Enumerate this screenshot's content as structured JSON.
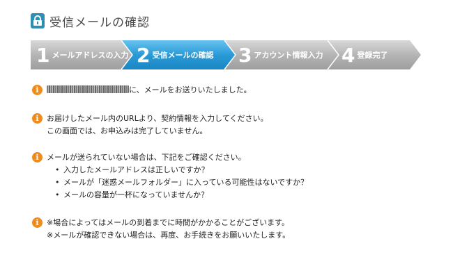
{
  "header": {
    "title": "受信メールの確認",
    "icon": "lock-icon",
    "accent": "#2e8fb5"
  },
  "steps": [
    {
      "num": "1",
      "label": "メールアドレスの入力",
      "active": false
    },
    {
      "num": "2",
      "label": "受信メールの確認",
      "active": true
    },
    {
      "num": "3",
      "label": "アカウント情報入力",
      "active": false
    },
    {
      "num": "4",
      "label": "登録完了",
      "active": false
    }
  ],
  "colors": {
    "step_inactive": "#b8b8b8",
    "step_active": "#3aa3d8",
    "info": "#f08c1e"
  },
  "messages": {
    "sent": {
      "suffix": "に、メールをお送りいたしました。"
    },
    "instruction": {
      "line1": "お届けしたメール内のURLより、契約情報を入力してください。",
      "line2": "この画面では、お申込みは完了していません。"
    },
    "not_received": {
      "line1": "メールが送られていない場合は、下記をご確認ください。",
      "items": [
        "入力したメールアドレスは正しいですか？",
        "メールが「迷惑メールフォルダー」に入っている可能性はないですか？",
        "メールの容量が一杯になっていませんか？"
      ]
    },
    "notes": {
      "line1": "※場合によってはメールの到着までに時間がかかることがございます。",
      "line2": "※メールが確認できない場合は、再度、お手続きをお願いいたします。"
    }
  }
}
